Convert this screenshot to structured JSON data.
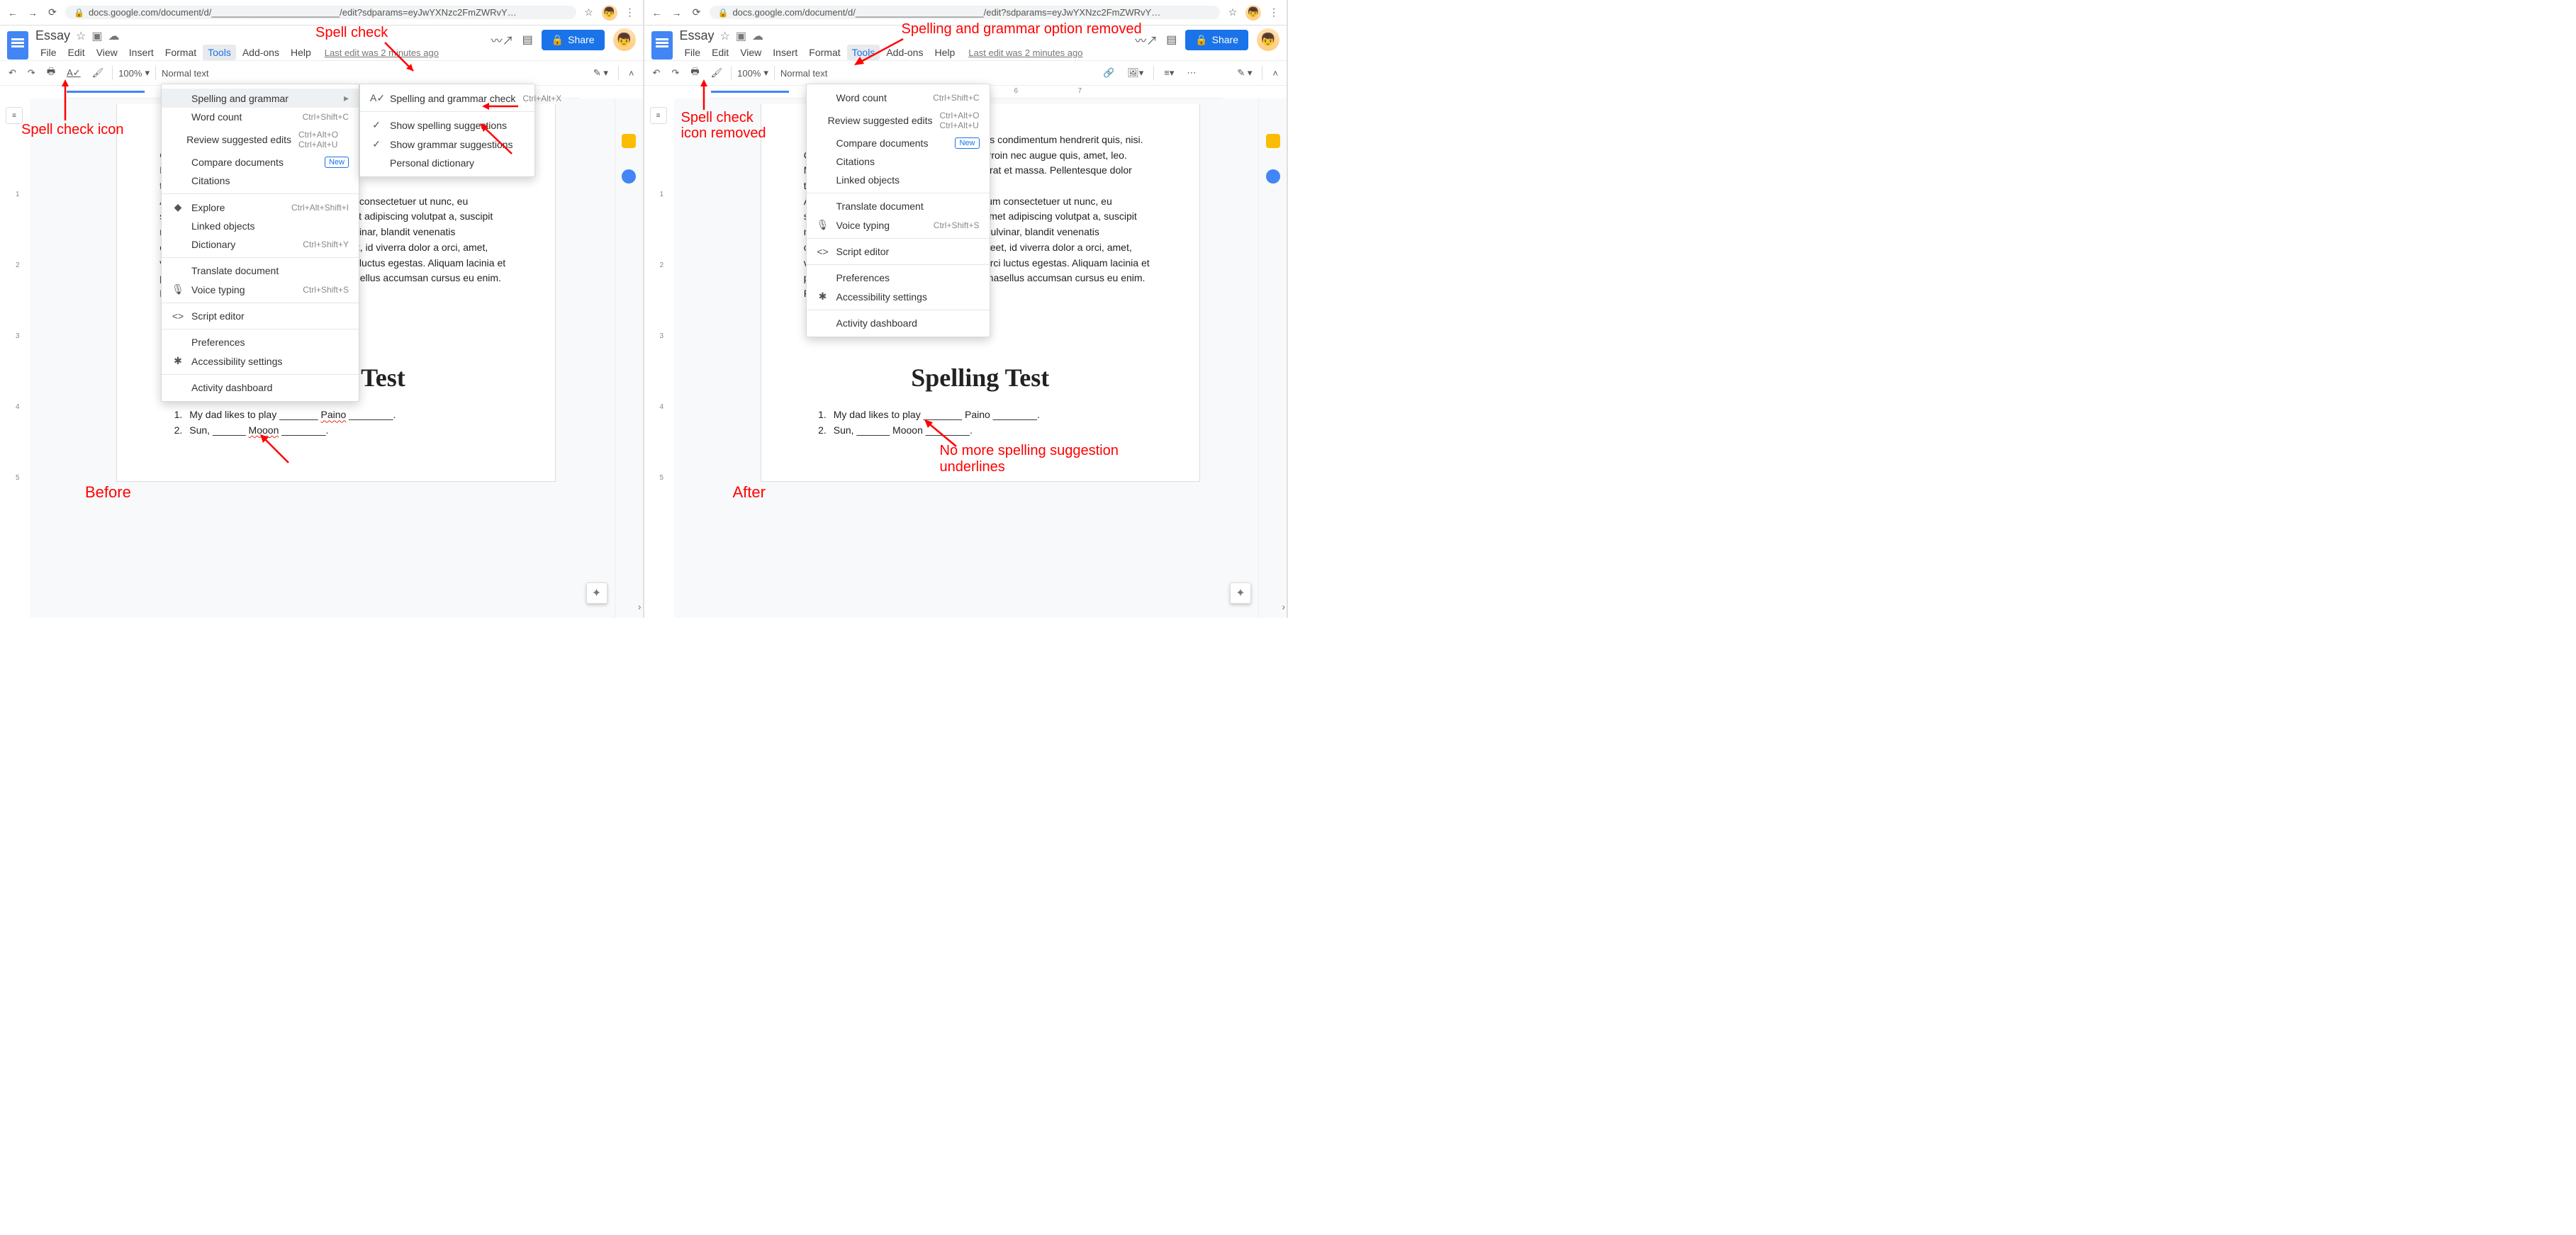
{
  "browser": {
    "url": "docs.google.com/document/d/_________________________/edit?sdparams=eyJwYXNzc2FmZWRvY…",
    "star": "☆"
  },
  "doc": {
    "title": "Essay",
    "menus": [
      "File",
      "Edit",
      "View",
      "Insert",
      "Format",
      "Tools",
      "Add-ons",
      "Help"
    ],
    "last_edit": "Last edit was 2 minutes ago",
    "share": "Share",
    "zoom": "100%",
    "style": "Normal text"
  },
  "body_text": "Nunc nec odio lacinia suscipit. Mauris condimentum hendrerit quis, nisi. Curabitur ligula sapien, tincidunt ultrices. Proin nec augue quis, amet, leo. Maecenas malesuada. Praesent congue erat et massa. Pellentesque dolor tortor. Donec posuere vulputate.\n        Aenean purus turpis suscipit sit amet, dictum consectetuer ut nunc, eu sollicitudin urna et dolor. Proin dictum sit amet adipiscing volutpat a, suscipit non, turpis. Nullam sagittis. Suspendisse pulvinar, blandit venenatis condimentum, sem libero volutpat orci laoreet, id viverra dolor a orci, amet, vestibulum ante ipsum primis in faucibus orci luctus egestas. Aliquam lacinia et porta id purus. Ut varius tincidunt libero. Phasellus accumsan cursus eu enim. Fire fox is really slow? That's impossible!",
  "spelling": {
    "title": "Spelling Test",
    "item1_pre": "My dad likes to play _______ ",
    "item1_word": "Paino",
    "item1_post": " ________.",
    "item2_pre": "Sun, ______ ",
    "item2_word": "Mooon",
    "item2_post": " ________."
  },
  "tools_menu_left": {
    "spelling_grammar": "Spelling and grammar",
    "word_count": "Word count",
    "word_count_s": "Ctrl+Shift+C",
    "review": "Review suggested edits",
    "review_s": "Ctrl+Alt+O Ctrl+Alt+U",
    "compare": "Compare documents",
    "new_badge": "New",
    "citations": "Citations",
    "explore": "Explore",
    "explore_s": "Ctrl+Alt+Shift+I",
    "linked": "Linked objects",
    "dictionary": "Dictionary",
    "dictionary_s": "Ctrl+Shift+Y",
    "translate": "Translate document",
    "voice": "Voice typing",
    "voice_s": "Ctrl+Shift+S",
    "script": "Script editor",
    "prefs": "Preferences",
    "access": "Accessibility settings",
    "activity": "Activity dashboard"
  },
  "submenu": {
    "check": "Spelling and grammar check",
    "check_s": "Ctrl+Alt+X",
    "show_sp": "Show spelling suggestions",
    "show_gr": "Show grammar suggestions",
    "personal": "Personal dictionary"
  },
  "tools_menu_right": {
    "word_count": "Word count",
    "word_count_s": "Ctrl+Shift+C",
    "review": "Review suggested edits",
    "review_s": "Ctrl+Alt+O Ctrl+Alt+U",
    "compare": "Compare documents",
    "new_badge": "New",
    "citations": "Citations",
    "linked": "Linked objects",
    "translate": "Translate document",
    "voice": "Voice typing",
    "voice_s": "Ctrl+Shift+S",
    "script": "Script editor",
    "prefs": "Preferences",
    "access": "Accessibility settings",
    "activity": "Activity dashboard"
  },
  "annotations": {
    "spell_check": "Spell check",
    "spell_icon": "Spell check icon",
    "spell_icon_removed": "Spell check icon removed",
    "sg_removed": "Spelling and grammar option removed",
    "no_underlines": "No more spelling suggestion underlines",
    "before": "Before",
    "after": "After"
  }
}
